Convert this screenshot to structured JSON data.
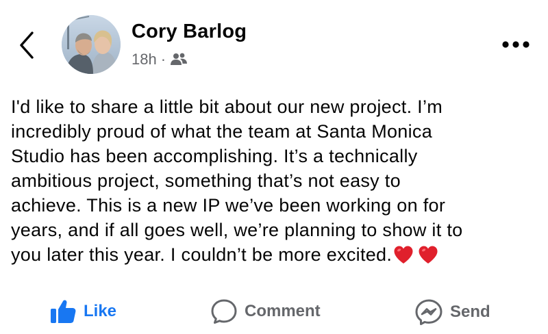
{
  "header": {
    "back_icon": "chevron-left-icon",
    "author_name": "Cory Barlog",
    "timestamp": "18h",
    "separator": "·",
    "audience_icon": "friends-icon",
    "more_icon": "more-horizontal-icon"
  },
  "post": {
    "text": "I'd like to share a little bit about our new project. I’m\nincredibly proud of what the team at Santa Monica\nStudio has been accomplishing. It’s a technically\nambitious project, something that’s not easy to\nachieve. This is a new IP we’ve been working on for\nyears, and if all goes well, we’re planning to show it to\nyou later this year. I couldn’t be more excited.",
    "emoji": [
      "red-heart",
      "red-heart"
    ]
  },
  "actions": {
    "like_label": "Like",
    "comment_label": "Comment",
    "send_label": "Send"
  },
  "colors": {
    "like_blue": "#1877f2",
    "secondary_gray": "#65676b",
    "heart_red": "#e0202c"
  }
}
